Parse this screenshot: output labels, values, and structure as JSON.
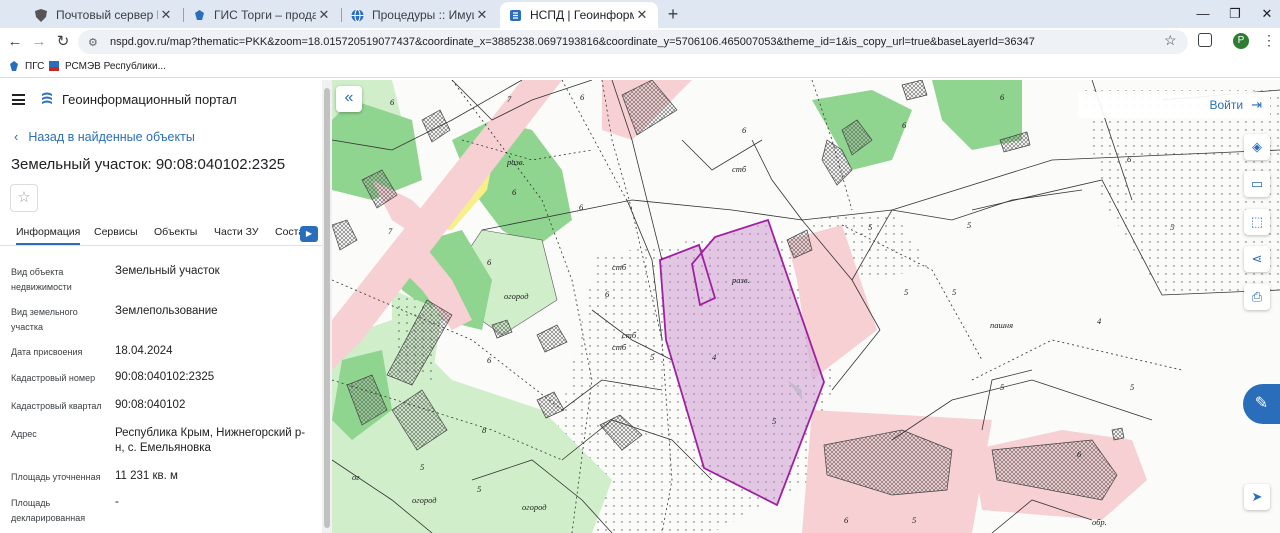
{
  "browser": {
    "tabs": [
      {
        "title": "Почтовый сервер Правитель",
        "active": false
      },
      {
        "title": "ГИС Торги – продажи государ",
        "active": false
      },
      {
        "title": "Процедуры :: Имущественны",
        "active": false
      },
      {
        "title": "НСПД | Геоинформационный",
        "active": true
      }
    ],
    "new_tab": "+",
    "url": "nspd.gov.ru/map?thematic=PKK&zoom=18.015720519077437&coordinate_x=3885238.0697193816&coordinate_y=5706106.465007053&theme_id=1&is_copy_url=true&baseLayerId=36347",
    "profile_letter": "P",
    "bookmarks": [
      "ПГС",
      "РСМЭВ Республики..."
    ]
  },
  "portal": {
    "title": "Геоинформационный портал",
    "back_link": "Назад в найденные объекты",
    "object_title": "Земельный участок: 90:08:040102:2325",
    "tabs": [
      "Информация",
      "Сервисы",
      "Объекты",
      "Части ЗУ",
      "Соста"
    ],
    "properties": [
      {
        "label": "Вид объекта недвижимости",
        "value": "Земельный участок"
      },
      {
        "label": "Вид земельного участка",
        "value": "Землепользование"
      },
      {
        "label": "Дата присвоения",
        "value": "18.04.2024"
      },
      {
        "label": "Кадастровый номер",
        "value": "90:08:040102:2325"
      },
      {
        "label": "Кадастровый квартал",
        "value": "90:08:040102"
      },
      {
        "label": "Адрес",
        "value": "Республика Крым, Нижнегорский р-н, с. Емельяновка"
      },
      {
        "label": "Площадь уточненная",
        "value": "11 231 кв. м"
      },
      {
        "label": "Площадь декларированная",
        "value": "-"
      }
    ]
  },
  "map": {
    "login_label": "Войти",
    "labels": {
      "razv": "разв.",
      "stb": "стб",
      "ogorod": "огород",
      "pashnya": "пашня",
      "og": "ог",
      "obr": "обр.",
      "n4": "4",
      "n5": "5",
      "n6": "6",
      "n7": "7",
      "n8": "8"
    },
    "colors": {
      "selected_parcel": "#a020a0",
      "green_area": "#8fd48f",
      "light_green": "#cfeec9",
      "pink_zone": "#f6d0d3",
      "yellow_area": "#f7ef8a",
      "accent": "#2a6ebb"
    }
  }
}
